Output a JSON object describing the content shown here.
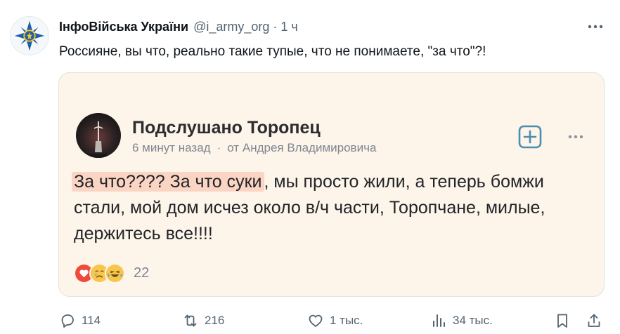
{
  "tweet": {
    "author_name": "ІнфоВійська України",
    "author_handle": "@i_army_org",
    "separator": "·",
    "time": "1 ч",
    "text": "Россияне, вы что, реально такие тупые, что не понимаете, \"за что\"?!"
  },
  "embedded_post": {
    "community": "Подслушано Торопец",
    "time": "6 минут назад",
    "separator": "·",
    "source": "от Андрея Владимировича",
    "highlighted_text": "За что???? За что суки",
    "text_rest": ", мы просто жили, а теперь бомжи стали, мой дом исчез около в/ч части, Торопчане, милые, держитесь все!!!!",
    "reactions_count": "22",
    "reaction_icons": [
      "heart-emoji-icon",
      "crying-emoji-icon",
      "laughing-tears-emoji-icon"
    ]
  },
  "actions": {
    "replies": "114",
    "reposts": "216",
    "likes": "1 тыс.",
    "views": "34 тыс."
  },
  "colors": {
    "card_background": "#fdf4ea",
    "highlight": "#fbd5c4",
    "add_button": "#4a8fb0",
    "secondary_text": "#536471"
  }
}
